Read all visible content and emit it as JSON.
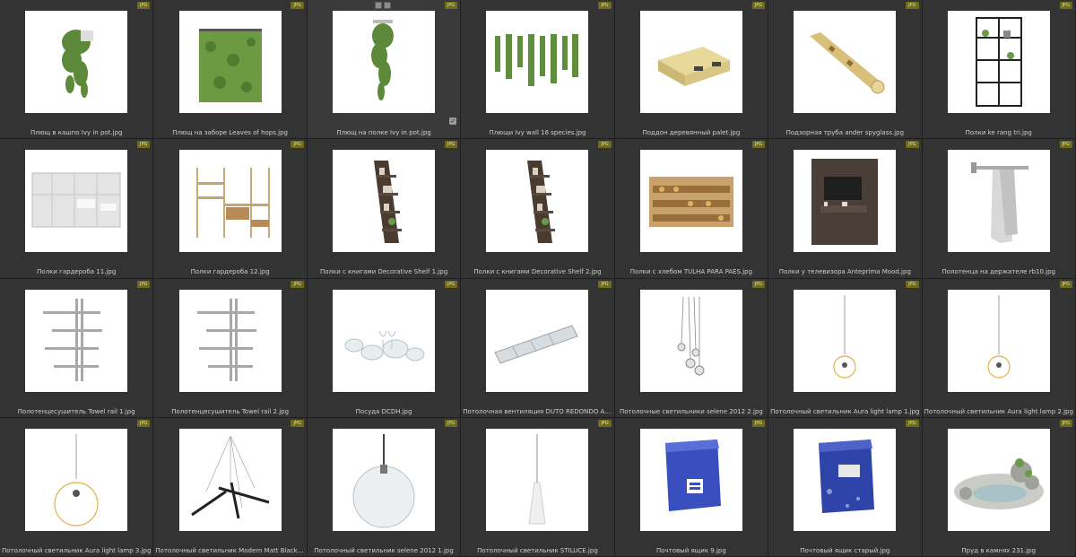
{
  "badge_label": "JPG",
  "items": [
    {
      "caption": "Плющ в кашпо Ivy in pot.jpg",
      "icon": "ivy-pot-icon"
    },
    {
      "caption": "Плющ на заборе Leaves of hops.jpg",
      "icon": "ivy-fence-icon"
    },
    {
      "caption": "Плющ на полке Ivy in pot.jpg",
      "icon": "ivy-shelf-icon"
    },
    {
      "caption": "Плющи Ivy wall 16 species.jpg",
      "icon": "ivy-wall-icon"
    },
    {
      "caption": "Поддон деревянный palet.jpg",
      "icon": "pallet-icon"
    },
    {
      "caption": "Подзорная труба ander spyglass.jpg",
      "icon": "spyglass-icon"
    },
    {
      "caption": "Полки ke rang tri.jpg",
      "icon": "shelf-rack-icon"
    },
    {
      "caption": "Полки гардероба 11.jpg",
      "icon": "wardrobe-icon"
    },
    {
      "caption": "Полки гардероба 12.jpg",
      "icon": "wardrobe-open-icon"
    },
    {
      "caption": "Полки с книгами Decorative Shelf 1.jpg",
      "icon": "ladder-shelf-icon"
    },
    {
      "caption": "Полки с книгами Decorative Shelf 2.jpg",
      "icon": "ladder-shelf-icon"
    },
    {
      "caption": "Полки с хлебом TULHA PARA PAES.jpg",
      "icon": "bread-shelf-icon"
    },
    {
      "caption": "Полки у телевизора Anteprima Mood.jpg",
      "icon": "tv-unit-icon"
    },
    {
      "caption": "Полотенца на держателе rb10.jpg",
      "icon": "towel-holder-icon"
    },
    {
      "caption": "Полотенцесушитель Towel rail 1.jpg",
      "icon": "towel-rail-icon"
    },
    {
      "caption": "Полотенцесушитель Towel rail 2.jpg",
      "icon": "towel-rail-icon"
    },
    {
      "caption": "Посуда DCDH.jpg",
      "icon": "dishes-icon"
    },
    {
      "caption": "Потолочная вентиляция DUTO REDONDO AR CONDICIONADO.jpg",
      "icon": "duct-icon"
    },
    {
      "caption": "Потолочные светильники selene 2012 2.jpg",
      "icon": "pendant-cluster-icon"
    },
    {
      "caption": "Потолочный светильник Aura light lamp 1.jpg",
      "icon": "ring-lamp-icon"
    },
    {
      "caption": "Потолочный светильник Aura light lamp 2.jpg",
      "icon": "ring-lamp-icon"
    },
    {
      "caption": "Потолочный светильник Aura light lamp 3.jpg",
      "icon": "ring-lamp-large-icon"
    },
    {
      "caption": "Потолочный светильник Modern Matt Black Chandelier.jpg",
      "icon": "chandelier-icon"
    },
    {
      "caption": "Потолочный светильник selene 2012 1.jpg",
      "icon": "globe-lamp-icon"
    },
    {
      "caption": "Потолочный светильник STILUCE.jpg",
      "icon": "cone-lamp-icon"
    },
    {
      "caption": "Почтовый ящик 9.jpg",
      "icon": "mailbox-icon"
    },
    {
      "caption": "Почтовый ящик старый.jpg",
      "icon": "mailbox-old-icon"
    },
    {
      "caption": "Пруд в камнях 231.jpg",
      "icon": "stone-pond-icon"
    }
  ]
}
